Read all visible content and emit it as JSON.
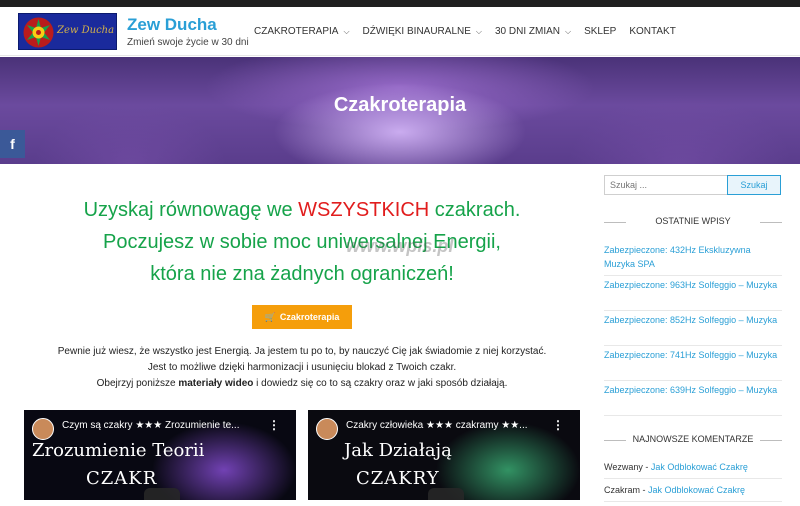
{
  "site": {
    "logo_script": "Zew Ducha",
    "title": "Zew Ducha",
    "tagline": "Zmień swoje życie w 30 dni"
  },
  "nav": {
    "items": [
      {
        "label": "CZAKROTERAPIA",
        "has_dropdown": true
      },
      {
        "label": "DŹWIĘKI BINAURALNE",
        "has_dropdown": true
      },
      {
        "label": "30 DNI ZMIAN",
        "has_dropdown": true
      },
      {
        "label": "SKLEP",
        "has_dropdown": false
      },
      {
        "label": "KONTAKT",
        "has_dropdown": false
      }
    ]
  },
  "hero": {
    "title": "Czakroterapia"
  },
  "social": {
    "facebook_label": "f"
  },
  "main": {
    "headline_1a": "Uzyskaj równowagę we ",
    "headline_1b": "WSZYSTKICH",
    "headline_1c": " czakrach.",
    "headline_2": "Poczujesz w sobie moc uniwersalnej Energii,",
    "headline_3": "która nie zna żadnych ograniczeń!",
    "watermark": "www.wpis.pl",
    "cta_label": "Czakroterapia",
    "text_1": "Pewnie już wiesz, że wszystko jest Energią. Ja jestem tu po to, by nauczyć Cię jak świadomie z niej korzystać.",
    "text_2": "Jest to możliwe dzięki harmonizacji i usunięciu blokad z Twoich czakr.",
    "text_3a": "Obejrzyj poniższe ",
    "text_3b": "materiały wideo",
    "text_3c": " i dowiedz się co to są czakry oraz w jaki sposób działają.",
    "videos": [
      {
        "title": "Czym są czakry ★★★ Zrozumienie te...",
        "overlay_1": "Zrozumienie Teorii",
        "overlay_2": "CZAKR"
      },
      {
        "title": "Czakry człowieka ★★★ czakramy ★★...",
        "overlay_1": "Jak Działają",
        "overlay_2": "CZAKRY"
      }
    ]
  },
  "sidebar": {
    "search_placeholder": "Szukaj ...",
    "search_button": "Szukaj",
    "recent_title": "OSTATNIE WPISY",
    "recent_posts": [
      "Zabezpieczone: 432Hz Ekskluzywna Muzyka SPA",
      "Zabezpieczone: 963Hz Solfeggio – Muzyka",
      "Zabezpieczone: 852Hz Solfeggio – Muzyka",
      "Zabezpieczone: 741Hz Solfeggio – Muzyka",
      "Zabezpieczone: 639Hz Solfeggio – Muzyka"
    ],
    "comments_title": "NAJNOWSZE KOMENTARZE",
    "comments": [
      {
        "author": "Wezwany",
        "sep": " - ",
        "post": "Jak Odblokować Czakrę"
      },
      {
        "author": "Czakram",
        "sep": " - ",
        "post": "Jak Odblokować Czakrę"
      }
    ]
  },
  "colors": {
    "brand_blue": "#2a9fd6",
    "headline_green": "#16a34a",
    "headline_red": "#e11d1d",
    "cta_orange": "#f59e0b",
    "facebook": "#3b5998"
  }
}
